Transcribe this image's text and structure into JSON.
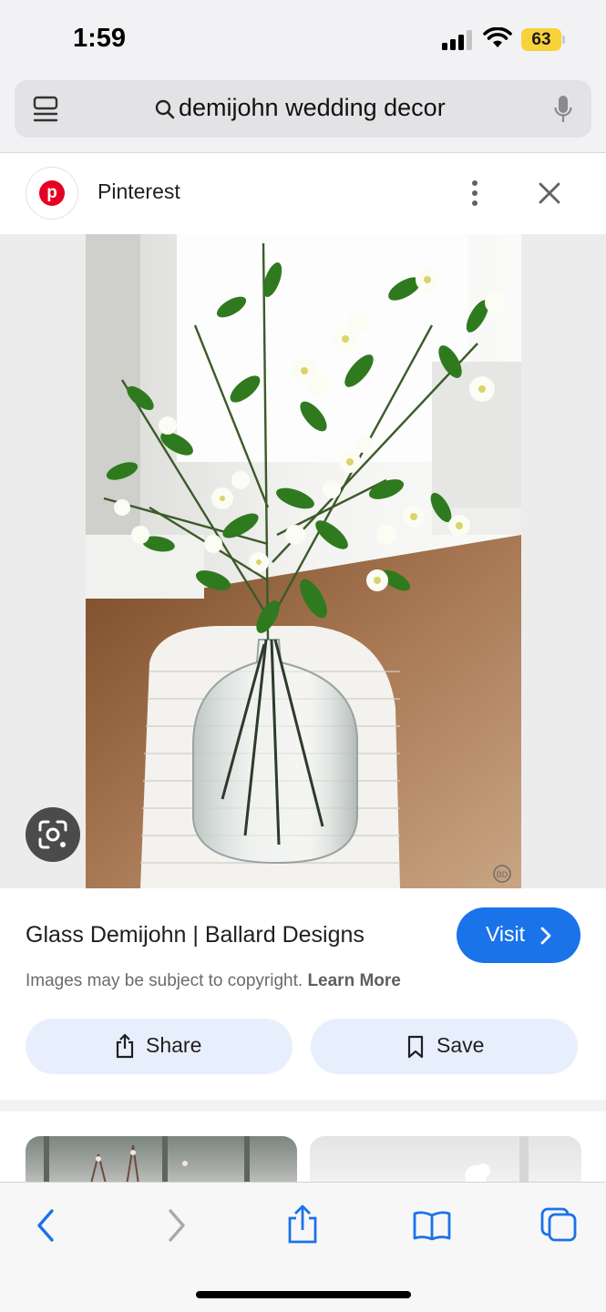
{
  "status_bar": {
    "time": "1:59",
    "battery_level": "63",
    "icons": [
      "signal-icon",
      "wifi-icon",
      "battery-icon"
    ]
  },
  "search": {
    "query": "demijohn wedding decor",
    "icons": [
      "tabs-icon",
      "search-icon",
      "microphone-icon"
    ]
  },
  "source": {
    "name": "Pinterest",
    "logo_icon": "pinterest-logo",
    "logo_glyph": "p",
    "brand_color": "#e60023"
  },
  "image": {
    "watermark_glyph": "BD"
  },
  "result": {
    "title": "Glass Demijohn | Ballard Designs",
    "visit_label": "Visit",
    "copyright_text": "Images may be subject to copyright.",
    "learn_more_label": "Learn More",
    "share_label": "Share",
    "save_label": "Save",
    "accent_color": "#1a73e8"
  },
  "toolbar": {
    "icons": [
      "back-icon",
      "forward-icon",
      "share-icon",
      "bookmarks-icon",
      "tabs-icon"
    ]
  }
}
